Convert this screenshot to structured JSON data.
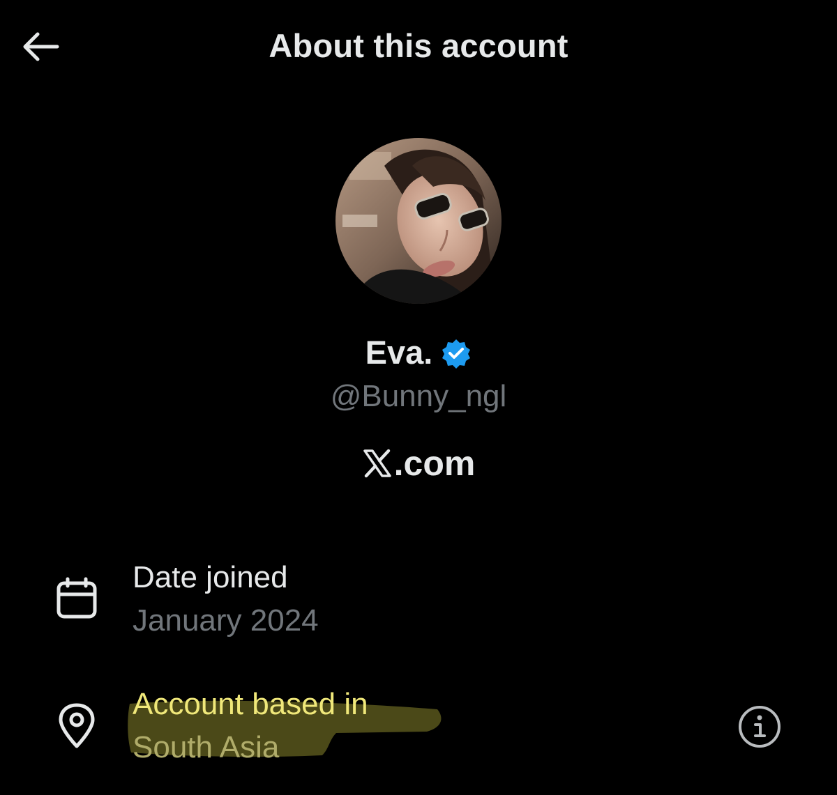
{
  "header": {
    "title": "About this account",
    "back_icon": "arrow-left-icon"
  },
  "profile": {
    "avatar_icon": "profile-photo",
    "name": "Eva.",
    "verified_icon": "verified-badge-icon",
    "verified_color": "#1d9bf0",
    "handle": "@Bunny_ngl",
    "site_logo_icon": "x-logo-icon",
    "site_suffix": ".com"
  },
  "details": {
    "date_joined": {
      "icon": "calendar-icon",
      "label": "Date joined",
      "value": "January 2024"
    },
    "account_based_in": {
      "icon": "location-pin-icon",
      "label": "Account based in",
      "value": "South Asia",
      "info_icon": "info-icon",
      "highlight_color": "#e8e34a"
    }
  },
  "colors": {
    "background": "#000000",
    "primary_text": "#e7e9ea",
    "secondary_text": "#71767b"
  }
}
